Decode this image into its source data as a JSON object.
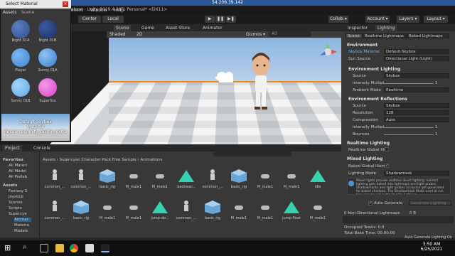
{
  "remote_bar": {
    "title": "54.206.39.142"
  },
  "window": {
    "title": "nas Standalone - Unity 2019.4.28f1 Personal* <DX11>"
  },
  "menu": {
    "items": [
      "mponent",
      "Window",
      "Help"
    ]
  },
  "toolbar": {
    "center": "Center",
    "local": "Local",
    "collab": "Collab ▾",
    "account": "Account ▾",
    "layers": "Layers ▾",
    "layout": "Layout ▾"
  },
  "picker": {
    "title": "Select Material",
    "tabs": [
      "Assets",
      "Scene"
    ],
    "items": [
      {
        "label": "Night 01A",
        "color": "#2d4f8e"
      },
      {
        "label": "Night 01B",
        "color": "#1b2e66"
      },
      {
        "label": "Player",
        "color": "#3d86d8"
      },
      {
        "label": "Sunny 01A",
        "color": "#3a7ed0"
      },
      {
        "label": "Sunny 01B",
        "color": "#58a8e8"
      },
      {
        "label": "Superfice",
        "color": "#d93fc7"
      }
    ],
    "preview_line1": "Default-Skybox",
    "preview_line2": "Material",
    "preview_line3": "Resources/unity_builtin_extra"
  },
  "scene": {
    "tabs": [
      "Scene",
      "Game",
      "Asset Store",
      "Animator"
    ],
    "shading": "Shaded",
    "mode": "2D",
    "gizmos": "Gizmos ▾",
    "search": "All"
  },
  "inspector": {
    "tabs": [
      "Inspector",
      "Lighting"
    ],
    "subtabs": [
      "Scene",
      "Realtime Lightmaps",
      "Baked Lightmaps"
    ],
    "environment": "Environment",
    "skybox_label": "Skybox Material",
    "skybox_value": "Default-Skybox",
    "sun_label": "Sun Source",
    "sun_value": "Directional Light (Light)",
    "env_lighting": "Environment Lighting",
    "source_label": "Source",
    "source_value": "Skybox",
    "intensity_label": "Intensity Multipl",
    "intensity_value": "1",
    "ambient_label": "Ambient Mode",
    "ambient_value": "Realtime",
    "env_reflect": "Environment Reflections",
    "rsource_label": "Source",
    "rsource_value": "Skybox",
    "res_label": "Resolution",
    "res_value": "128",
    "comp_label": "Compression",
    "comp_value": "Auto",
    "rint_label": "Intensity Multipl",
    "rint_value": "1",
    "bounce_label": "Bounces",
    "bounce_value": "1",
    "realtime_lighting": "Realtime Lighting",
    "realtime_gi": "Realtime Global Illu",
    "mixed": "Mixed Lighting",
    "baked_gi": "Baked Global Illum",
    "lighting_mode_label": "Lighting Mode",
    "lighting_mode_value": "Shadowmask",
    "info": "Mixed lights provide realtime direct lighting. Indirect lighting gets baked into lightmaps and light probes. Shadowmasks and light probes occlusion get generated for baked shadows. The Shadowmask Mode used at run time can be set in the Quality Settings",
    "auto_generate": "Auto Generate",
    "generate_lighting": "Generate Lighting",
    "non_dir": "0 Non-Directional Lightmaps",
    "non_dir_val": "0 B",
    "occupied": "Occupied Texels: 0.0",
    "bake_time": "Total Bake Time: 00:00:00",
    "status": "Auto Generate Lighting On"
  },
  "project": {
    "tabs": [
      "Project",
      "Console"
    ],
    "breadcrumb": "Assets › Supercyan Character Pack Free Sample › Animations",
    "tree": [
      "Favorites",
      "All Materi",
      "All Model",
      "All Prefab",
      "Assets",
      "Fantasy S",
      "Joystick",
      "Scenes",
      "Scripts",
      "Supercya",
      "Animat",
      "Materia",
      "Models"
    ],
    "row1": [
      "common_...",
      "common_...",
      "basic_rig",
      "M_male1",
      "M_male1",
      "backwar...",
      "common_...",
      "basic_rig",
      "M_male1",
      "M_male1",
      "idle"
    ],
    "row2": [
      "common_...",
      "basic_rig",
      "M_male1",
      "M_male1",
      "jump-do...",
      "common_...",
      "basic_rig",
      "M_male1",
      "M_male1",
      "jump-float",
      "M_male1"
    ]
  },
  "taskbar": {
    "time": "3:50 AM",
    "date": "6/25/2021"
  }
}
